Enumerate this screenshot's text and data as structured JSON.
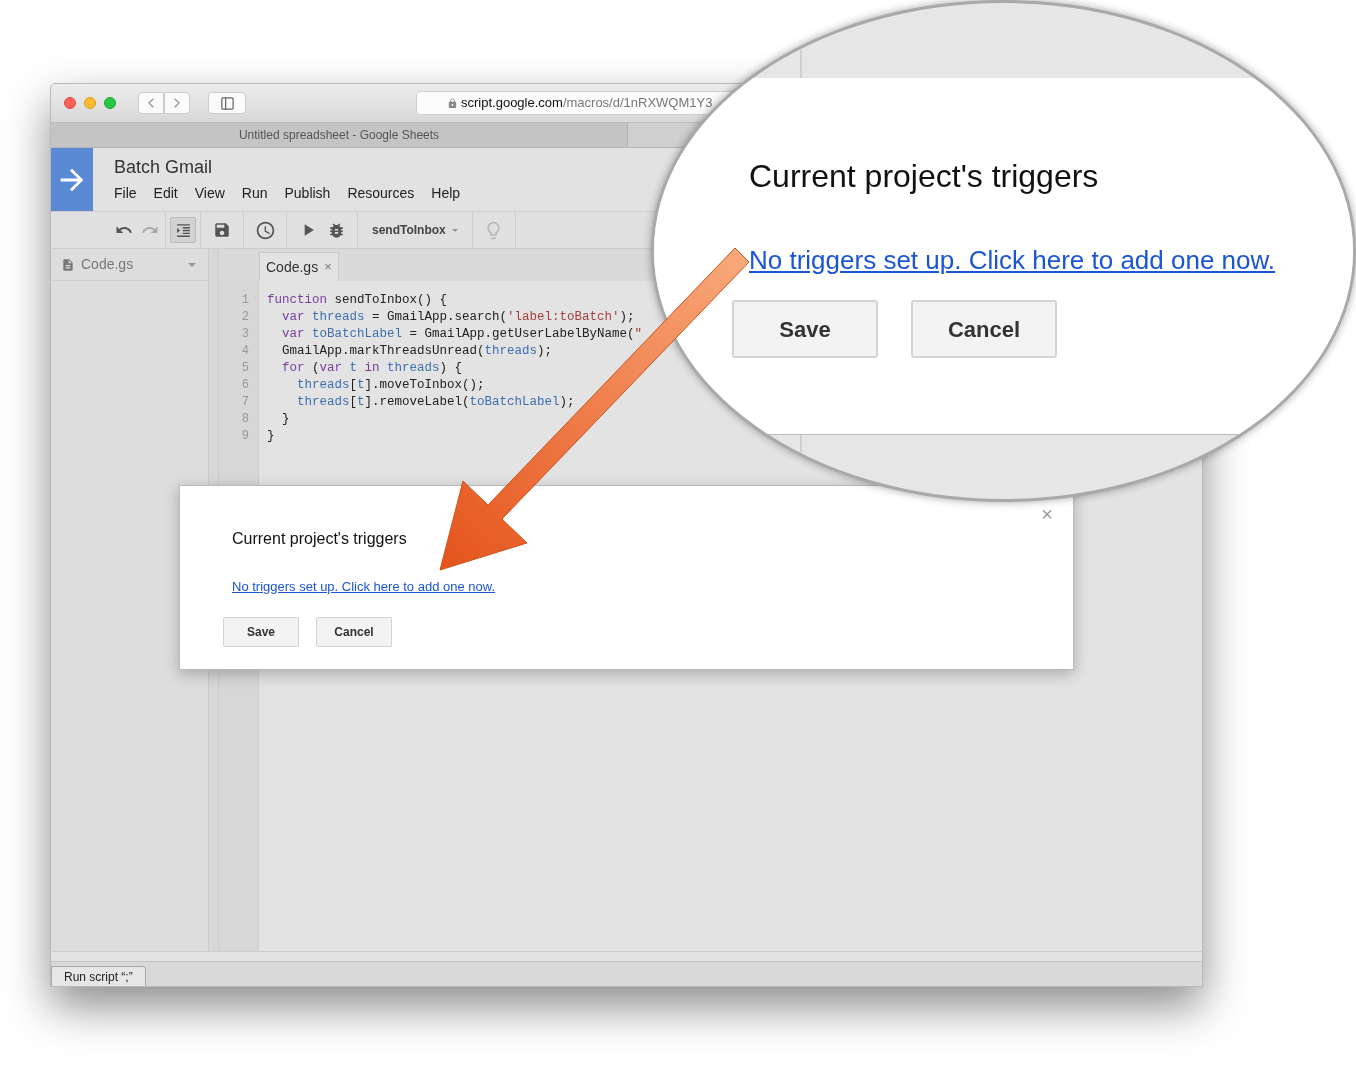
{
  "browser": {
    "url_host": "script.google.com",
    "url_path": "/macros/d/1nRXWQM1Y3",
    "tab_title": "Untitled spreadsheet - Google Sheets"
  },
  "app": {
    "title": "Batch Gmail",
    "menu": [
      "File",
      "Edit",
      "View",
      "Run",
      "Publish",
      "Resources",
      "Help"
    ],
    "function_select": "sendToInbox"
  },
  "sidebar": {
    "files": [
      {
        "name": "Code.gs"
      }
    ]
  },
  "editor": {
    "tabs": [
      {
        "label": "Code.gs",
        "close": "×"
      }
    ],
    "lines": [
      {
        "number": "1",
        "tokens": [
          {
            "kind": "keyword",
            "text": "function"
          },
          {
            "kind": "plain",
            "text": " sendToInbox() {"
          }
        ]
      },
      {
        "number": "2",
        "tokens": [
          {
            "kind": "keyword",
            "text": "  var"
          },
          {
            "kind": "variable",
            "text": " threads"
          },
          {
            "kind": "plain",
            "text": " = GmailApp.search("
          },
          {
            "kind": "string",
            "text": "'label:toBatch'"
          },
          {
            "kind": "plain",
            "text": ");"
          }
        ]
      },
      {
        "number": "3",
        "tokens": [
          {
            "kind": "keyword",
            "text": "  var"
          },
          {
            "kind": "variable",
            "text": " toBatchLabel"
          },
          {
            "kind": "plain",
            "text": " = GmailApp.getUserLabelByName("
          },
          {
            "kind": "string",
            "text": "\""
          }
        ]
      },
      {
        "number": "4",
        "tokens": [
          {
            "kind": "plain",
            "text": "  GmailApp.markThreadsUnread("
          },
          {
            "kind": "variable",
            "text": "threads"
          },
          {
            "kind": "plain",
            "text": ");"
          }
        ]
      },
      {
        "number": "5",
        "tokens": [
          {
            "kind": "keyword",
            "text": "  for"
          },
          {
            "kind": "plain",
            "text": " ("
          },
          {
            "kind": "keyword",
            "text": "var"
          },
          {
            "kind": "variable",
            "text": " t"
          },
          {
            "kind": "keyword",
            "text": " in"
          },
          {
            "kind": "variable",
            "text": " threads"
          },
          {
            "kind": "plain",
            "text": ") {"
          }
        ]
      },
      {
        "number": "6",
        "tokens": [
          {
            "kind": "variable",
            "text": "    threads"
          },
          {
            "kind": "plain",
            "text": "["
          },
          {
            "kind": "variable",
            "text": "t"
          },
          {
            "kind": "plain",
            "text": "].moveToInbox();"
          }
        ]
      },
      {
        "number": "7",
        "tokens": [
          {
            "kind": "variable",
            "text": "    threads"
          },
          {
            "kind": "plain",
            "text": "["
          },
          {
            "kind": "variable",
            "text": "t"
          },
          {
            "kind": "plain",
            "text": "].removeLabel("
          },
          {
            "kind": "variable",
            "text": "toBatchLabel"
          },
          {
            "kind": "plain",
            "text": ");"
          }
        ]
      },
      {
        "number": "8",
        "tokens": [
          {
            "kind": "plain",
            "text": "  }"
          }
        ]
      },
      {
        "number": "9",
        "tokens": [
          {
            "kind": "plain",
            "text": "}"
          }
        ]
      }
    ]
  },
  "dialog": {
    "title": "Current project's triggers",
    "link": "No triggers set up. Click here to add one now.",
    "buttons": [
      "Save",
      "Cancel"
    ],
    "close": "×"
  },
  "magnifier": {
    "title": "Current project's triggers",
    "link": "No triggers set up. Click here to add one now.",
    "buttons": [
      "Save",
      "Cancel"
    ]
  },
  "status_bar": {
    "message": "Run script “;”"
  }
}
